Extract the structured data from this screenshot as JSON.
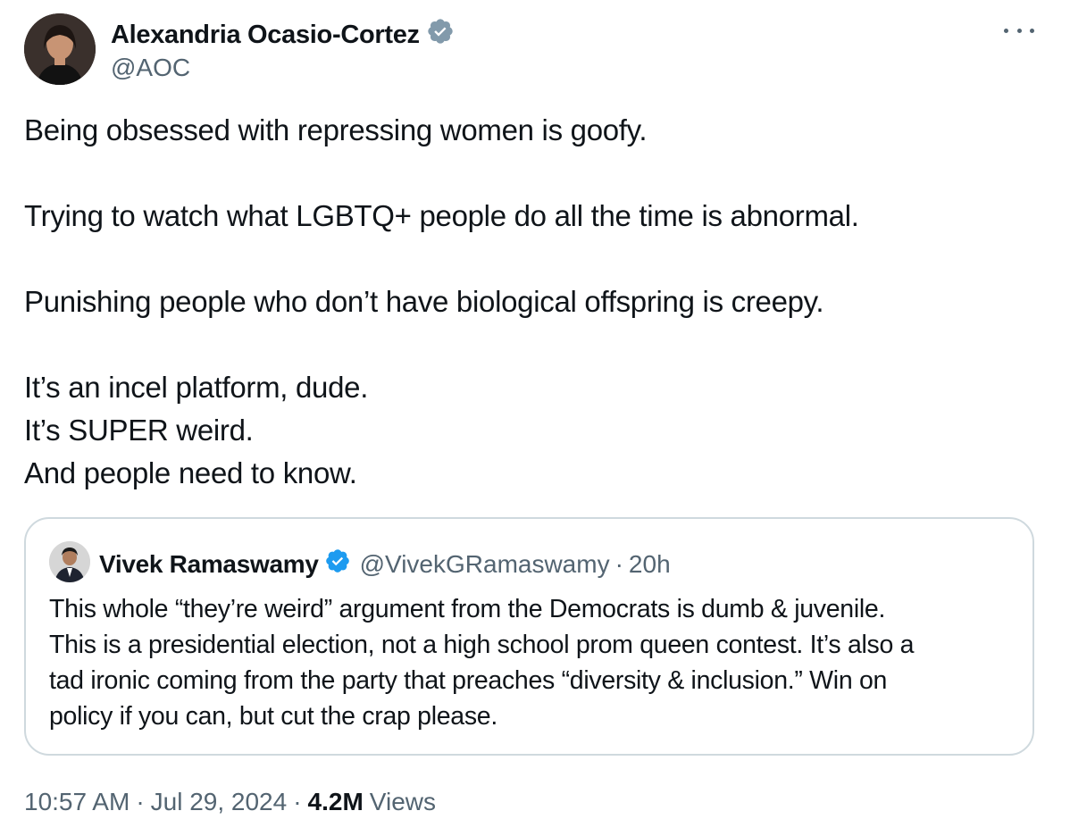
{
  "author": {
    "name": "Alexandria Ocasio-Cortez",
    "handle": "@AOC"
  },
  "tweet": {
    "paragraphs": [
      "Being obsessed with repressing women is goofy.",
      "Trying to watch what LGBTQ+ people do all the time is abnormal.",
      "Punishing people who don’t have biological offspring is creepy.",
      "It’s an incel platform, dude.",
      "It’s SUPER weird.",
      "And people need to know."
    ]
  },
  "quote": {
    "name": "Vivek Ramaswamy",
    "handle": "@VivekGRamaswamy",
    "separator": "·",
    "time": "20h",
    "lines": [
      "This whole “they’re weird” argument from the Democrats is dumb & juvenile.",
      "This is a presidential election, not a high school prom queen contest. It’s also a",
      "tad ironic coming from the party that preaches “diversity & inclusion.” Win on",
      "policy if you can, but cut the crap please."
    ]
  },
  "meta": {
    "time": "10:57 AM",
    "date": "Jul 29, 2024",
    "separator": "·",
    "views_count": "4.2M",
    "views_label": "Views"
  },
  "icons": {
    "verified": "verified-badge-icon",
    "more": "more-options-icon"
  },
  "colors": {
    "verified_gray": "#829aab",
    "verified_blue": "#1d9bf0",
    "secondary_text": "#536471",
    "border": "#cfd9de"
  }
}
